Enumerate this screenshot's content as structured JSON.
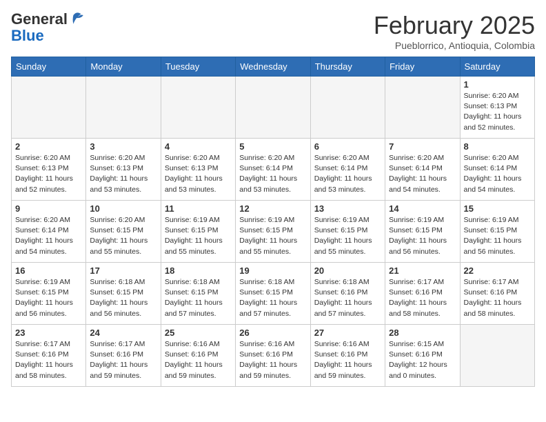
{
  "header": {
    "logo_general": "General",
    "logo_blue": "Blue",
    "month_title": "February 2025",
    "location": "Pueblorrico, Antioquia, Colombia"
  },
  "days_of_week": [
    "Sunday",
    "Monday",
    "Tuesday",
    "Wednesday",
    "Thursday",
    "Friday",
    "Saturday"
  ],
  "weeks": [
    [
      {
        "day": "",
        "info": ""
      },
      {
        "day": "",
        "info": ""
      },
      {
        "day": "",
        "info": ""
      },
      {
        "day": "",
        "info": ""
      },
      {
        "day": "",
        "info": ""
      },
      {
        "day": "",
        "info": ""
      },
      {
        "day": "1",
        "info": "Sunrise: 6:20 AM\nSunset: 6:13 PM\nDaylight: 11 hours\nand 52 minutes."
      }
    ],
    [
      {
        "day": "2",
        "info": "Sunrise: 6:20 AM\nSunset: 6:13 PM\nDaylight: 11 hours\nand 52 minutes."
      },
      {
        "day": "3",
        "info": "Sunrise: 6:20 AM\nSunset: 6:13 PM\nDaylight: 11 hours\nand 53 minutes."
      },
      {
        "day": "4",
        "info": "Sunrise: 6:20 AM\nSunset: 6:13 PM\nDaylight: 11 hours\nand 53 minutes."
      },
      {
        "day": "5",
        "info": "Sunrise: 6:20 AM\nSunset: 6:14 PM\nDaylight: 11 hours\nand 53 minutes."
      },
      {
        "day": "6",
        "info": "Sunrise: 6:20 AM\nSunset: 6:14 PM\nDaylight: 11 hours\nand 53 minutes."
      },
      {
        "day": "7",
        "info": "Sunrise: 6:20 AM\nSunset: 6:14 PM\nDaylight: 11 hours\nand 54 minutes."
      },
      {
        "day": "8",
        "info": "Sunrise: 6:20 AM\nSunset: 6:14 PM\nDaylight: 11 hours\nand 54 minutes."
      }
    ],
    [
      {
        "day": "9",
        "info": "Sunrise: 6:20 AM\nSunset: 6:14 PM\nDaylight: 11 hours\nand 54 minutes."
      },
      {
        "day": "10",
        "info": "Sunrise: 6:20 AM\nSunset: 6:15 PM\nDaylight: 11 hours\nand 55 minutes."
      },
      {
        "day": "11",
        "info": "Sunrise: 6:19 AM\nSunset: 6:15 PM\nDaylight: 11 hours\nand 55 minutes."
      },
      {
        "day": "12",
        "info": "Sunrise: 6:19 AM\nSunset: 6:15 PM\nDaylight: 11 hours\nand 55 minutes."
      },
      {
        "day": "13",
        "info": "Sunrise: 6:19 AM\nSunset: 6:15 PM\nDaylight: 11 hours\nand 55 minutes."
      },
      {
        "day": "14",
        "info": "Sunrise: 6:19 AM\nSunset: 6:15 PM\nDaylight: 11 hours\nand 56 minutes."
      },
      {
        "day": "15",
        "info": "Sunrise: 6:19 AM\nSunset: 6:15 PM\nDaylight: 11 hours\nand 56 minutes."
      }
    ],
    [
      {
        "day": "16",
        "info": "Sunrise: 6:19 AM\nSunset: 6:15 PM\nDaylight: 11 hours\nand 56 minutes."
      },
      {
        "day": "17",
        "info": "Sunrise: 6:18 AM\nSunset: 6:15 PM\nDaylight: 11 hours\nand 56 minutes."
      },
      {
        "day": "18",
        "info": "Sunrise: 6:18 AM\nSunset: 6:15 PM\nDaylight: 11 hours\nand 57 minutes."
      },
      {
        "day": "19",
        "info": "Sunrise: 6:18 AM\nSunset: 6:15 PM\nDaylight: 11 hours\nand 57 minutes."
      },
      {
        "day": "20",
        "info": "Sunrise: 6:18 AM\nSunset: 6:16 PM\nDaylight: 11 hours\nand 57 minutes."
      },
      {
        "day": "21",
        "info": "Sunrise: 6:17 AM\nSunset: 6:16 PM\nDaylight: 11 hours\nand 58 minutes."
      },
      {
        "day": "22",
        "info": "Sunrise: 6:17 AM\nSunset: 6:16 PM\nDaylight: 11 hours\nand 58 minutes."
      }
    ],
    [
      {
        "day": "23",
        "info": "Sunrise: 6:17 AM\nSunset: 6:16 PM\nDaylight: 11 hours\nand 58 minutes."
      },
      {
        "day": "24",
        "info": "Sunrise: 6:17 AM\nSunset: 6:16 PM\nDaylight: 11 hours\nand 59 minutes."
      },
      {
        "day": "25",
        "info": "Sunrise: 6:16 AM\nSunset: 6:16 PM\nDaylight: 11 hours\nand 59 minutes."
      },
      {
        "day": "26",
        "info": "Sunrise: 6:16 AM\nSunset: 6:16 PM\nDaylight: 11 hours\nand 59 minutes."
      },
      {
        "day": "27",
        "info": "Sunrise: 6:16 AM\nSunset: 6:16 PM\nDaylight: 11 hours\nand 59 minutes."
      },
      {
        "day": "28",
        "info": "Sunrise: 6:15 AM\nSunset: 6:16 PM\nDaylight: 12 hours\nand 0 minutes."
      },
      {
        "day": "",
        "info": ""
      }
    ]
  ]
}
